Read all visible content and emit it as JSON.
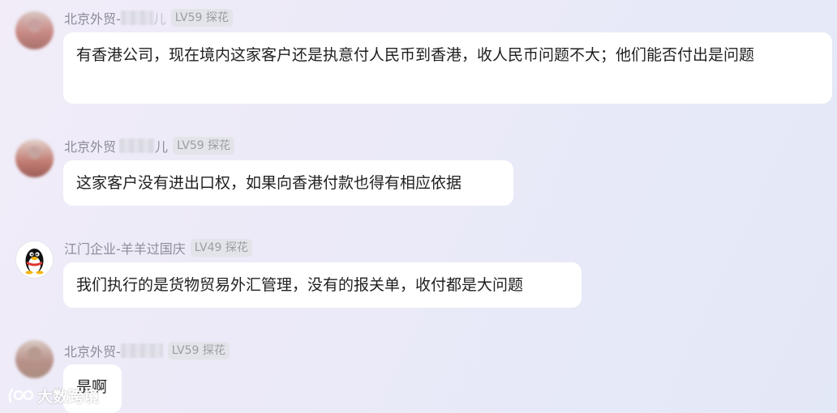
{
  "messages": [
    {
      "nick": "北京外贸-",
      "nick_suffix": "儿",
      "level": "LV59 探花",
      "text": "有香港公司，现在境内这家客户还是执意付人民币到香港，收人民币问题不大；他们能否付出是问题"
    },
    {
      "nick": "北京外贸",
      "nick_suffix": "儿",
      "level": "LV59 探花",
      "text": "这家客户没有进出口权，如果向香港付款也得有相应依据"
    },
    {
      "nick": "江门企业-羊羊过国庆",
      "level": "LV49 探花",
      "text": "我们执行的是货物贸易外汇管理，没有的报关单，收付都是大问题"
    },
    {
      "nick": "北京外贸-",
      "level": "LV59 探花",
      "text": "是啊"
    }
  ],
  "watermark": {
    "text": "大数跨境",
    "icon": "brand-logo-icon"
  },
  "colors": {
    "bubble": "#ffffff",
    "nick": "#8c8c99",
    "level_bg": "#e3e3ea",
    "text": "#1f1f1f"
  }
}
